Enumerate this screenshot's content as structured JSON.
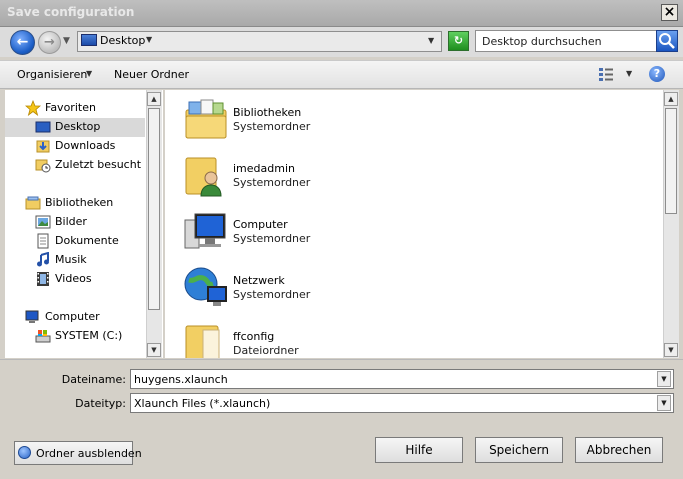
{
  "window": {
    "title": "Save configuration",
    "close_label": "×"
  },
  "address": {
    "location": "Desktop",
    "search_placeholder": "Desktop durchsuchen"
  },
  "toolbar": {
    "organize_label": "Organisieren",
    "new_folder_label": "Neuer Ordner"
  },
  "nav": {
    "favorites_header": "Favoriten",
    "favorites": [
      {
        "label": "Desktop",
        "icon": "desktop-icon",
        "selected": true
      },
      {
        "label": "Downloads",
        "icon": "downloads-icon"
      },
      {
        "label": "Zuletzt besucht",
        "icon": "recent-places-icon"
      }
    ],
    "libraries_header": "Bibliotheken",
    "libraries": [
      {
        "label": "Bilder",
        "icon": "pictures-icon"
      },
      {
        "label": "Dokumente",
        "icon": "documents-icon"
      },
      {
        "label": "Musik",
        "icon": "music-icon"
      },
      {
        "label": "Videos",
        "icon": "videos-icon"
      }
    ],
    "computer_header": "Computer",
    "drives": [
      {
        "label": "SYSTEM (C:)",
        "icon": "drive-icon"
      }
    ]
  },
  "files": [
    {
      "name": "Bibliotheken",
      "type": "Systemordner",
      "icon": "libraries-folder-icon"
    },
    {
      "name": "imedadmin",
      "type": "Systemordner",
      "icon": "user-folder-icon"
    },
    {
      "name": "Computer",
      "type": "Systemordner",
      "icon": "computer-icon"
    },
    {
      "name": "Netzwerk",
      "type": "Systemordner",
      "icon": "network-icon"
    },
    {
      "name": "ffconfig",
      "type": "Dateiordner",
      "icon": "folder-icon"
    }
  ],
  "form": {
    "filename_label": "Dateiname:",
    "filename_value": "huygens.xlaunch",
    "filetype_label": "Dateityp:",
    "filetype_value": "Xlaunch Files (*.xlaunch)"
  },
  "buttons": {
    "hide_folders": "Ordner ausblenden",
    "help": "Hilfe",
    "save": "Speichern",
    "cancel": "Abbrechen"
  }
}
